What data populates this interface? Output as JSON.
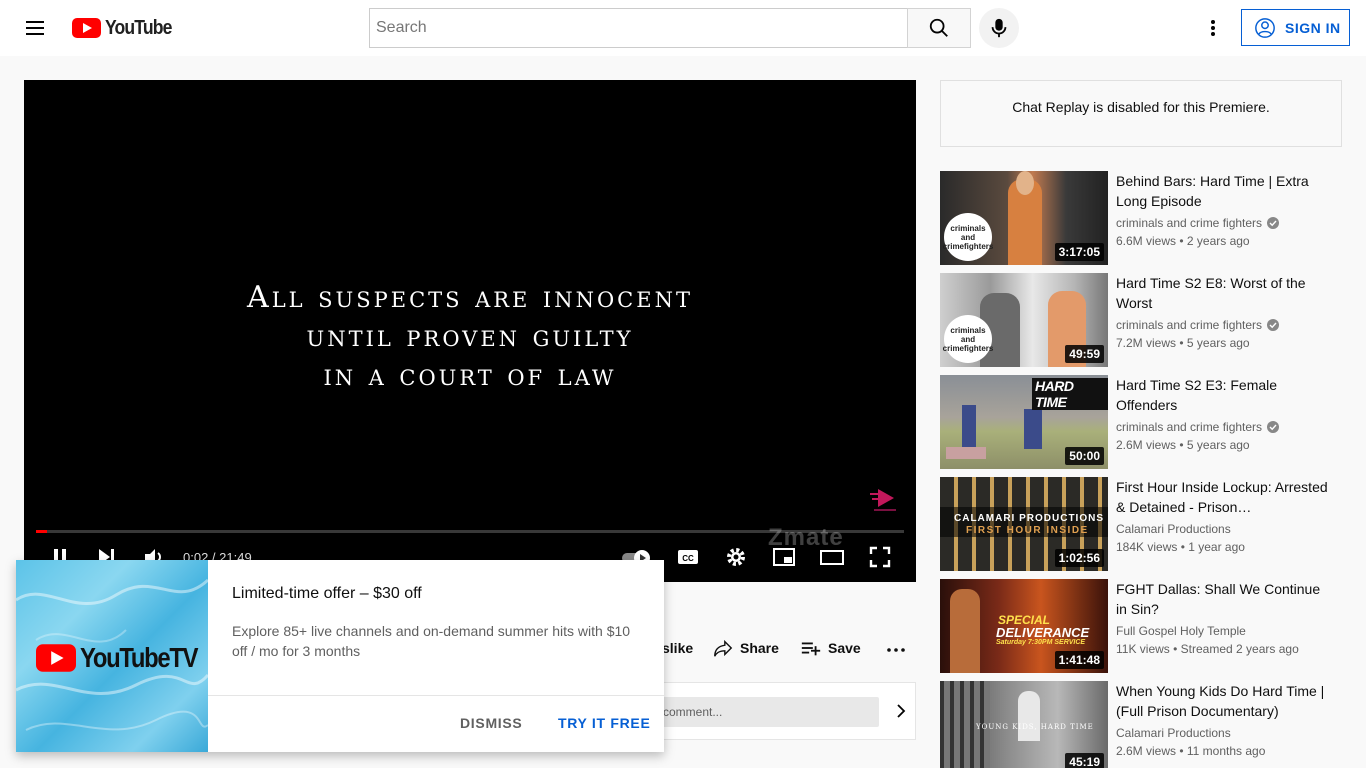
{
  "masthead": {
    "logo_text": "YouTube",
    "search_placeholder": "Search",
    "signin_label": "SIGN IN"
  },
  "player": {
    "disclaimer_lines": [
      "All suspects are innocent",
      "until proven guilty",
      "in a court of law"
    ],
    "time": "0:02 / 21:49",
    "progress": 0.013,
    "watermark": "Zmate",
    "accent": "#ff0000"
  },
  "actions": {
    "dislike_label": "slike",
    "share_label": "Share",
    "save_label": "Save"
  },
  "comment": {
    "placeholder": "comment..."
  },
  "promo": {
    "logo_text": "YouTubeTV",
    "title": "Limited-time offer – $30 off",
    "description": "Explore 85+ live channels and on-demand summer hits with $10 off / mo for 3 months",
    "dismiss_label": "DISMISS",
    "try_label": "TRY IT FREE"
  },
  "sidebar": {
    "chat_replay": "Chat Replay is disabled for this Premiere.",
    "recommendations": [
      {
        "title": "Behind Bars: Hard Time | Extra Long Episode",
        "channel": "criminals and crime fighters",
        "verified": true,
        "meta": "6.6M views • 2 years ago",
        "duration": "3:17:05",
        "badge": "criminals and crimefighters"
      },
      {
        "title": "Hard Time S2 E8: Worst of the Worst",
        "channel": "criminals and crime fighters",
        "verified": true,
        "meta": "7.2M views • 5 years ago",
        "duration": "49:59",
        "badge": "criminals and crimefighters"
      },
      {
        "title": "Hard Time S2 E3: Female Offenders",
        "channel": "criminals and crime fighters",
        "verified": true,
        "meta": "2.6M views • 5 years ago",
        "duration": "50:00",
        "overlay": "HARD TIME"
      },
      {
        "title": "First Hour Inside Lockup: Arrested & Detained - Prison…",
        "channel": "Calamari Productions",
        "verified": false,
        "meta": "184K views • 1 year ago",
        "duration": "1:02:56",
        "overlay": "CALAMARI PRODUCTIONS",
        "overlay2": "FIRST HOUR INSIDE"
      },
      {
        "title": "FGHT Dallas: Shall We Continue in Sin?",
        "channel": "Full Gospel Holy Temple",
        "verified": false,
        "meta": "11K views • Streamed 2 years ago",
        "duration": "1:41:48",
        "overlay": "SPECIAL",
        "overlay2": "DELIVERANCE",
        "overlay3": "Saturday 7:30PM SERVICE"
      },
      {
        "title": "When Young Kids Do Hard Time | (Full Prison Documentary)",
        "channel": "Calamari Productions",
        "verified": false,
        "meta": "2.6M views • 11 months ago",
        "duration": "45:19",
        "overlay": "YOUNG KIDS, HARD TIME"
      }
    ]
  }
}
